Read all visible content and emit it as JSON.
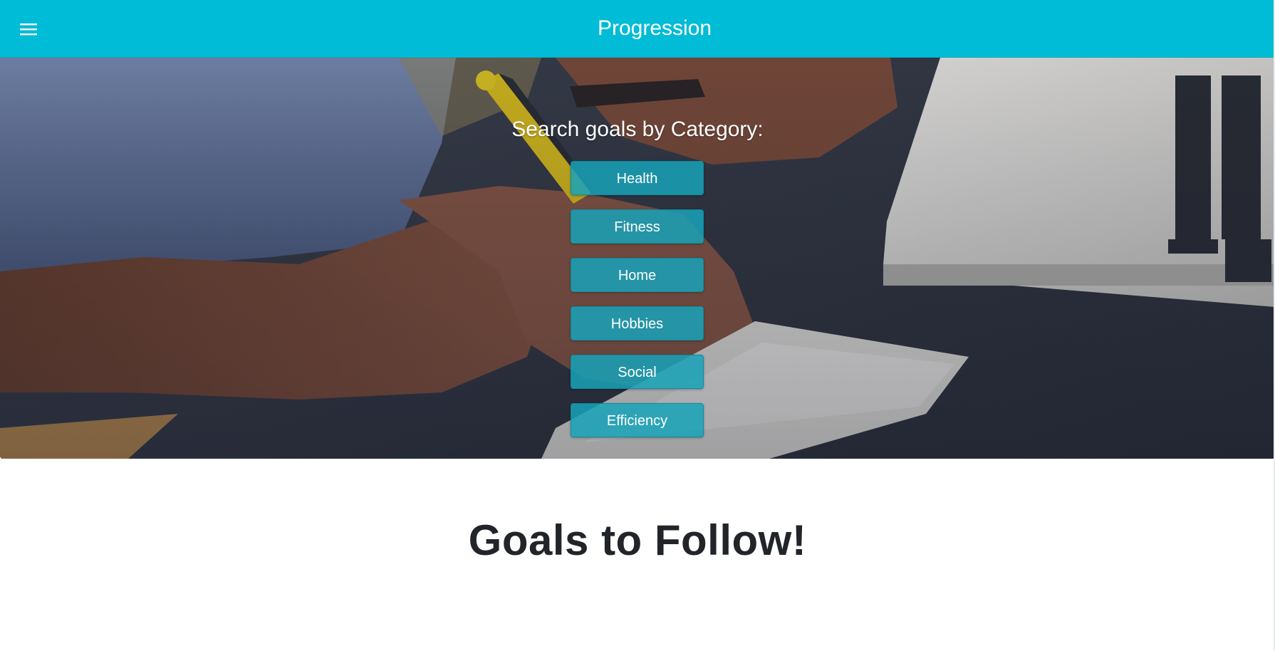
{
  "header": {
    "title": "Progression",
    "menu_icon": "hamburger-menu-icon",
    "background_color": "#00bcd6"
  },
  "hero": {
    "heading": "Search goals by Category:",
    "categories": [
      {
        "label": "Health"
      },
      {
        "label": "Fitness"
      },
      {
        "label": "Home"
      },
      {
        "label": "Hobbies"
      },
      {
        "label": "Social"
      },
      {
        "label": "Efficiency"
      }
    ],
    "button_color": "#17a2b8"
  },
  "main": {
    "section_title": "Goals to Follow!"
  }
}
